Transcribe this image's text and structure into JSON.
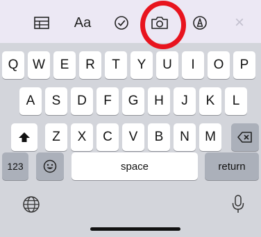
{
  "toolbar": {
    "items": [
      {
        "name": "table-icon"
      },
      {
        "name": "text-format-icon",
        "label": "Aa"
      },
      {
        "name": "checklist-icon"
      },
      {
        "name": "camera-icon"
      },
      {
        "name": "markup-pen-icon"
      },
      {
        "name": "close-icon",
        "label": "×"
      }
    ],
    "annotation_color": "#e8141e"
  },
  "keyboard": {
    "row1": [
      "Q",
      "W",
      "E",
      "R",
      "T",
      "Y",
      "U",
      "I",
      "O",
      "P"
    ],
    "row2": [
      "A",
      "S",
      "D",
      "F",
      "G",
      "H",
      "J",
      "K",
      "L"
    ],
    "row3": [
      "Z",
      "X",
      "C",
      "V",
      "B",
      "N",
      "M"
    ],
    "numbers_label": "123",
    "space_label": "space",
    "return_label": "return"
  }
}
